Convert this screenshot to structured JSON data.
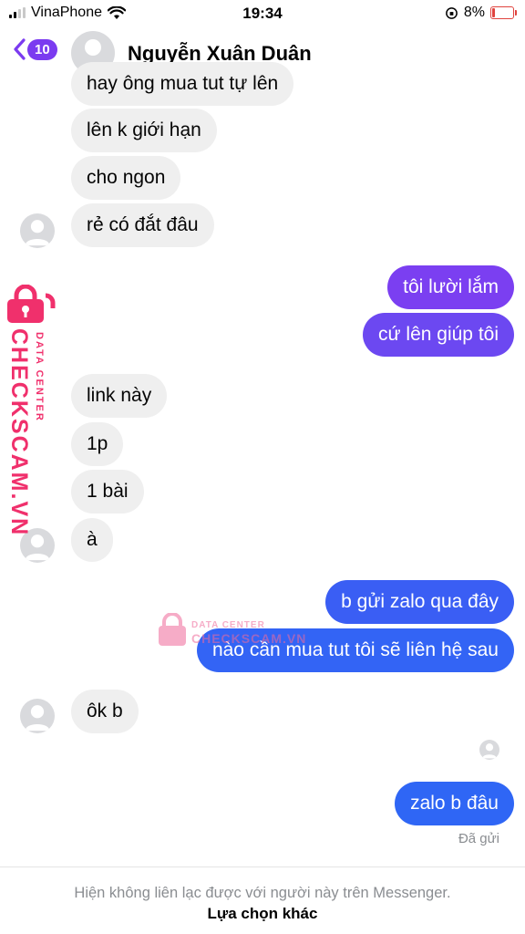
{
  "status_bar": {
    "carrier": "VinaPhone",
    "time": "19:34",
    "battery": "8%"
  },
  "header": {
    "back_count": "10",
    "contact_name": "Nguyễn Xuân Duân"
  },
  "messages": [
    {
      "text": "hay ông mua tut tự lên"
    },
    {
      "text": "lên k giới hạn"
    },
    {
      "text": "cho ngon"
    },
    {
      "text": "rẻ có đắt đâu"
    },
    {
      "text": "tôi lười lắm"
    },
    {
      "text": "cứ lên giúp tôi"
    },
    {
      "text": "link này"
    },
    {
      "text": "1p"
    },
    {
      "text": "1 bài"
    },
    {
      "text": "à"
    },
    {
      "text": "b gửi zalo qua đây"
    },
    {
      "text": "nào cần mua tut tôi sẽ liên hệ sau"
    },
    {
      "text": "ôk b"
    },
    {
      "text": "zalo b đâu"
    }
  ],
  "delivery_status": "Đã gửi",
  "footer": {
    "info": "Hiện không liên lạc được với người này trên Messenger.",
    "action": "Lựa chọn khác"
  },
  "watermark": {
    "brand": "CHECKSCAM.VN",
    "tag": "DATA CENTER"
  },
  "colors": {
    "incoming_bubble": "#efefef",
    "gradient_purple": "#7b3bf0",
    "gradient_blue": "#2f66f5",
    "watermark": "#f0306c"
  }
}
